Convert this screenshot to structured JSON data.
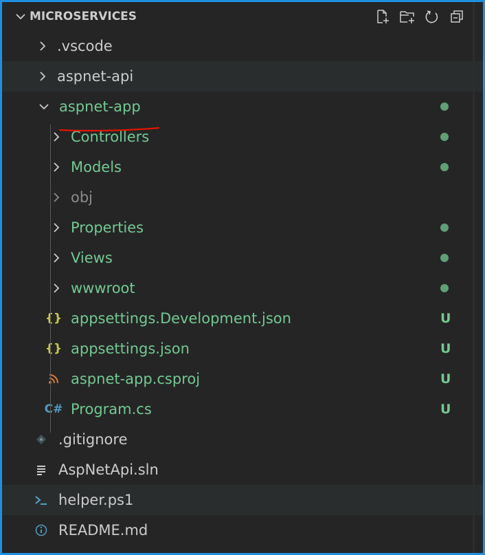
{
  "explorer": {
    "section_title": "MICROSERVICES",
    "actions": [
      {
        "name": "new-file-icon"
      },
      {
        "name": "new-folder-icon"
      },
      {
        "name": "refresh-icon"
      },
      {
        "name": "collapse-all-icon"
      }
    ]
  },
  "tree": {
    "vscode": ".vscode",
    "aspnet_api": "aspnet-api",
    "aspnet_app": "aspnet-app",
    "controllers": "Controllers",
    "models": "Models",
    "obj": "obj",
    "properties": "Properties",
    "views": "Views",
    "wwwroot": "wwwroot",
    "appsettings_dev": "appsettings.Development.json",
    "appsettings": "appsettings.json",
    "csproj": "aspnet-app.csproj",
    "program": "Program.cs",
    "gitignore": ".gitignore",
    "sln": "AspNetApi.sln",
    "helper": "helper.ps1",
    "readme": "README.md"
  },
  "git_status": {
    "untracked": "U"
  },
  "icons": {
    "json_glyph": "{}",
    "csharp_glyph": "C#"
  },
  "colors": {
    "accent_border": "#1e8fe0",
    "untracked_green": "#73c991",
    "annotation_red": "#e51400"
  }
}
